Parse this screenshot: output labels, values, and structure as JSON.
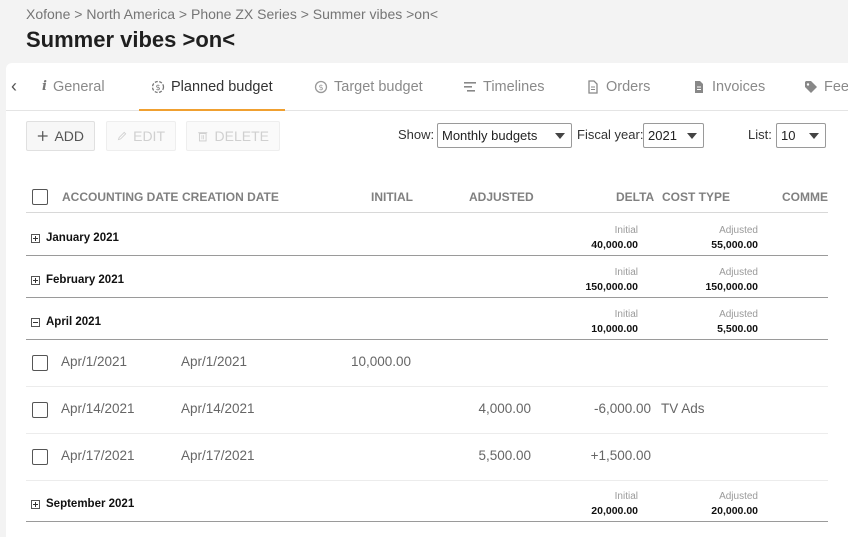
{
  "breadcrumb": "Xofone > North America > Phone ZX Series > Summer vibes >on<",
  "page_title": "Summer vibes >on<",
  "tabs": [
    {
      "label": "General",
      "icon": "info-icon"
    },
    {
      "label": "Planned budget",
      "icon": "budget-icon",
      "active": true
    },
    {
      "label": "Target budget",
      "icon": "target-icon"
    },
    {
      "label": "Timelines",
      "icon": "timeline-icon"
    },
    {
      "label": "Orders",
      "icon": "document-icon"
    },
    {
      "label": "Invoices",
      "icon": "invoice-icon"
    },
    {
      "label": "Fee",
      "icon": "tag-icon"
    }
  ],
  "toolbar": {
    "add": "ADD",
    "edit": "EDIT",
    "delete": "DELETE"
  },
  "filters": {
    "show_label": "Show:",
    "show_value": "Monthly budgets",
    "fiscal_label": "Fiscal year:",
    "fiscal_value": "2021",
    "list_label": "List:",
    "list_value": "10"
  },
  "columns": [
    "ACCOUNTING DATE",
    "CREATION DATE",
    "INITIAL",
    "ADJUSTED",
    "DELTA",
    "COST TYPE",
    "COMME"
  ],
  "summary_labels": {
    "initial": "Initial",
    "adjusted": "Adjusted"
  },
  "groups": [
    {
      "title": "January 2021",
      "initial": "40,000.00",
      "adjusted": "55,000.00",
      "expanded": false
    },
    {
      "title": "February 2021",
      "initial": "150,000.00",
      "adjusted": "150,000.00",
      "expanded": false
    },
    {
      "title": "April 2021",
      "initial": "10,000.00",
      "adjusted": "5,500.00",
      "expanded": true
    },
    {
      "title": "September 2021",
      "initial": "20,000.00",
      "adjusted": "20,000.00",
      "expanded": false
    }
  ],
  "rows": [
    {
      "accounting_date": "Apr/1/2021",
      "creation_date": "Apr/1/2021",
      "initial": "10,000.00",
      "adjusted": "",
      "delta": "",
      "cost_type": ""
    },
    {
      "accounting_date": "Apr/14/2021",
      "creation_date": "Apr/14/2021",
      "initial": "",
      "adjusted": "4,000.00",
      "delta": "-6,000.00",
      "cost_type": "TV Ads"
    },
    {
      "accounting_date": "Apr/17/2021",
      "creation_date": "Apr/17/2021",
      "initial": "",
      "adjusted": "5,500.00",
      "delta": "+1,500.00",
      "cost_type": ""
    }
  ],
  "colors": {
    "accent": "#f0a030",
    "background": "#f3f3f3",
    "panel": "#ffffff"
  }
}
